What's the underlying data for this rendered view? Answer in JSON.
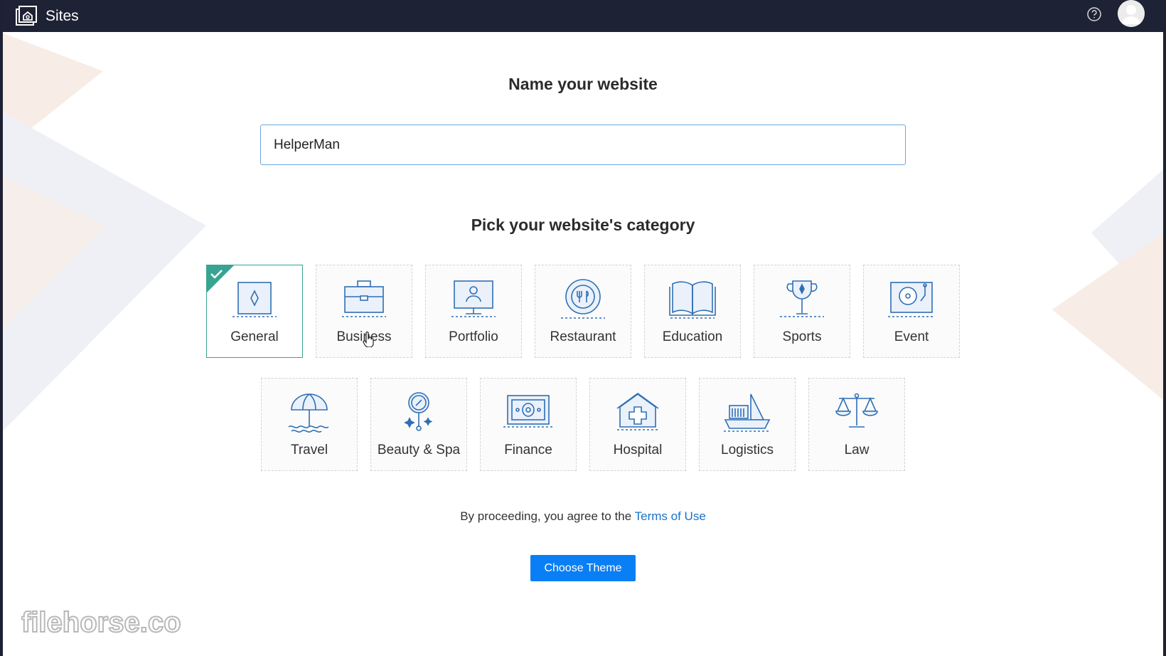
{
  "topbar": {
    "app_title": "Sites",
    "logo_icon": "sites-logo-icon",
    "help_icon": "help-icon",
    "avatar_icon": "user-avatar-icon"
  },
  "form": {
    "name_heading": "Name your website",
    "name_value": "HelperMan",
    "category_heading": "Pick your website's category",
    "selected_category": "General"
  },
  "categories_row1": [
    {
      "label": "General",
      "icon": "website-icon"
    },
    {
      "label": "Business",
      "icon": "briefcase-icon"
    },
    {
      "label": "Portfolio",
      "icon": "monitor-profile-icon"
    },
    {
      "label": "Restaurant",
      "icon": "plate-cutlery-icon"
    },
    {
      "label": "Education",
      "icon": "open-book-icon"
    },
    {
      "label": "Sports",
      "icon": "trophy-icon"
    },
    {
      "label": "Event",
      "icon": "turntable-icon"
    }
  ],
  "categories_row2": [
    {
      "label": "Travel",
      "icon": "beach-umbrella-icon"
    },
    {
      "label": "Beauty & Spa",
      "icon": "mirror-icon"
    },
    {
      "label": "Finance",
      "icon": "banknote-icon"
    },
    {
      "label": "Hospital",
      "icon": "hospital-icon"
    },
    {
      "label": "Logistics",
      "icon": "cargo-ship-icon"
    },
    {
      "label": "Law",
      "icon": "scales-icon"
    }
  ],
  "terms": {
    "prefix": "By proceeding, you agree to the ",
    "link": "Terms of Use"
  },
  "actions": {
    "choose_theme": "Choose Theme"
  },
  "watermark": {
    "text": "filehorse.com"
  },
  "colors": {
    "topbar": "#1e2235",
    "accent": "#0a7ff5",
    "selected": "#37a393",
    "icon": "#2f6fb5",
    "link": "#1a73c9"
  }
}
